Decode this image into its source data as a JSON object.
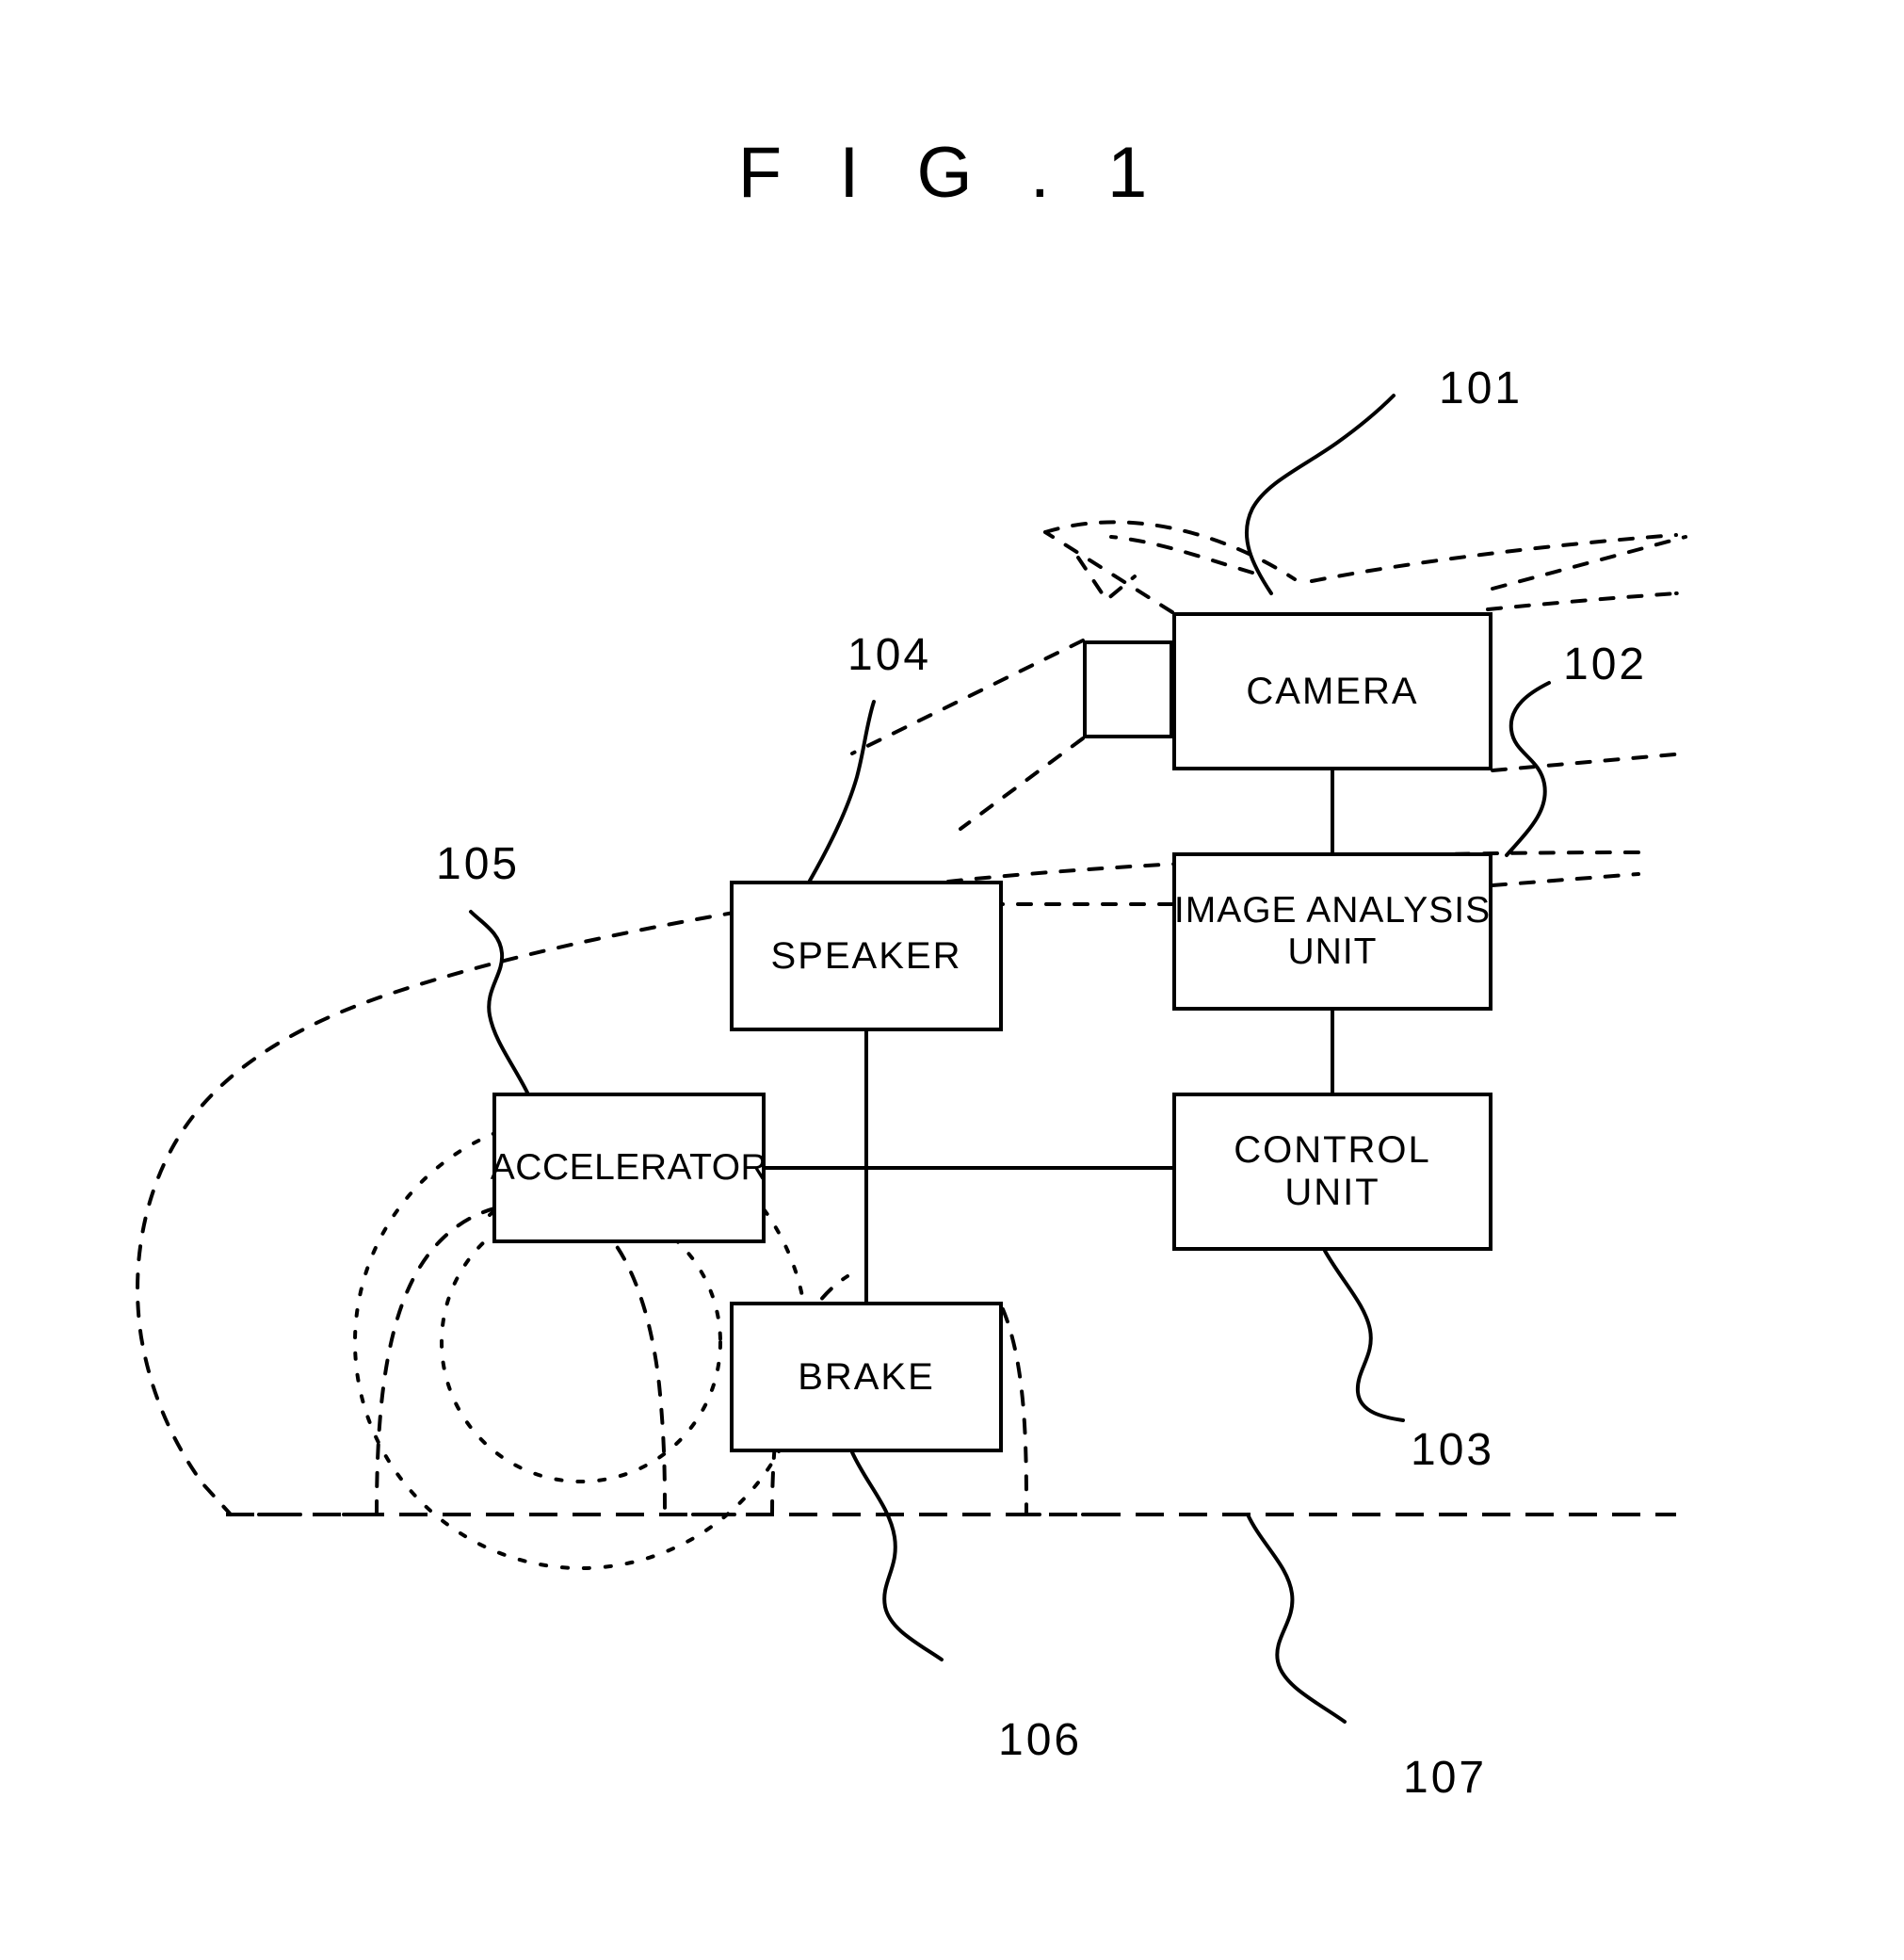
{
  "figure": {
    "title": "F I G . 1",
    "type": "patent-block-diagram",
    "description": "Vehicle system block diagram shown inside a dashed vehicle outline"
  },
  "blocks": [
    {
      "id": "camera",
      "label": "CAMERA",
      "numeral": "101"
    },
    {
      "id": "lens",
      "label": "",
      "numeral": ""
    },
    {
      "id": "image_unit",
      "label": "IMAGE ANALYSIS\nUNIT",
      "numeral": "102"
    },
    {
      "id": "control",
      "label": "CONTROL\nUNIT",
      "numeral": "103"
    },
    {
      "id": "speaker",
      "label": "SPEAKER",
      "numeral": "104"
    },
    {
      "id": "accelerator",
      "label": "ACCELERATOR",
      "numeral": "105"
    },
    {
      "id": "brake",
      "label": "BRAKE",
      "numeral": "106"
    }
  ],
  "reference_numerals": {
    "n101": "101",
    "n102": "102",
    "n103": "103",
    "n104": "104",
    "n105": "105",
    "n106": "106",
    "n107": "107"
  },
  "colors": {
    "line": "#000000",
    "background": "#ffffff"
  }
}
